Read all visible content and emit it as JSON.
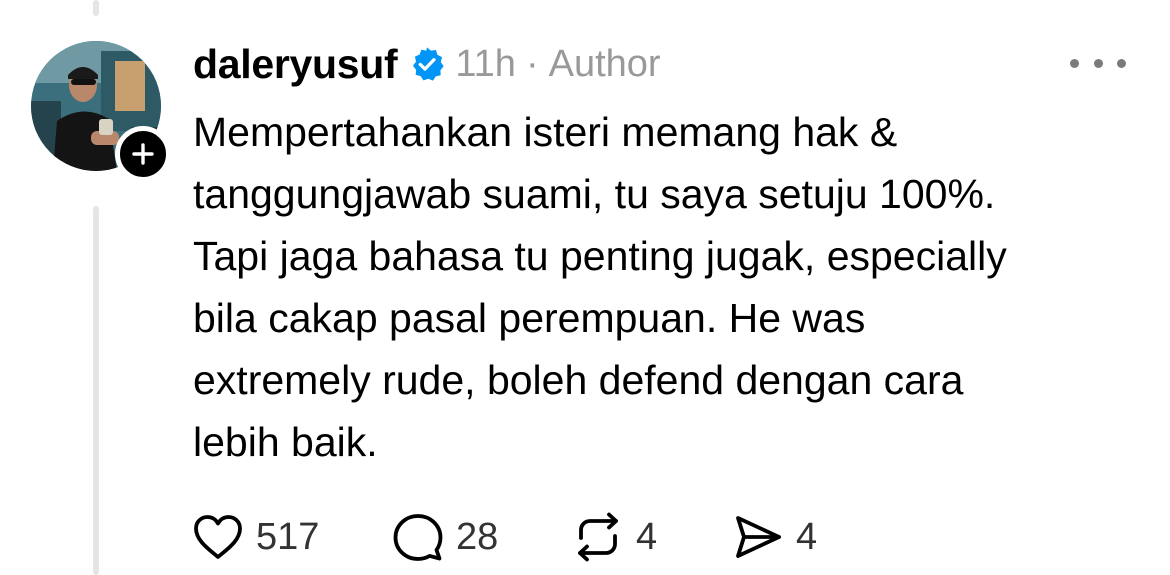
{
  "post": {
    "username": "daleryusuf",
    "time": "11h",
    "separator": "·",
    "author_tag": "Author",
    "text": "Mempertahankan isteri memang hak &\ntanggungjawab suami, tu saya setuju 100%.\nTapi jaga bahasa tu penting jugak, especially\nbila cakap pasal perempuan. He was\nextremely rude, boleh defend dengan cara\nlebih baik.",
    "stats": {
      "likes": "517",
      "replies": "28",
      "reposts": "4",
      "shares": "4"
    }
  },
  "icons": {
    "verified": "verified-badge-icon",
    "follow": "plus-icon",
    "more": "more-dots-icon",
    "like": "heart-icon",
    "reply": "comment-bubble-icon",
    "repost": "repost-arrows-icon",
    "share": "send-icon"
  },
  "colors": {
    "verified_blue": "#0095f6",
    "muted_text": "#999999",
    "thread_line": "#e5e5e5"
  }
}
